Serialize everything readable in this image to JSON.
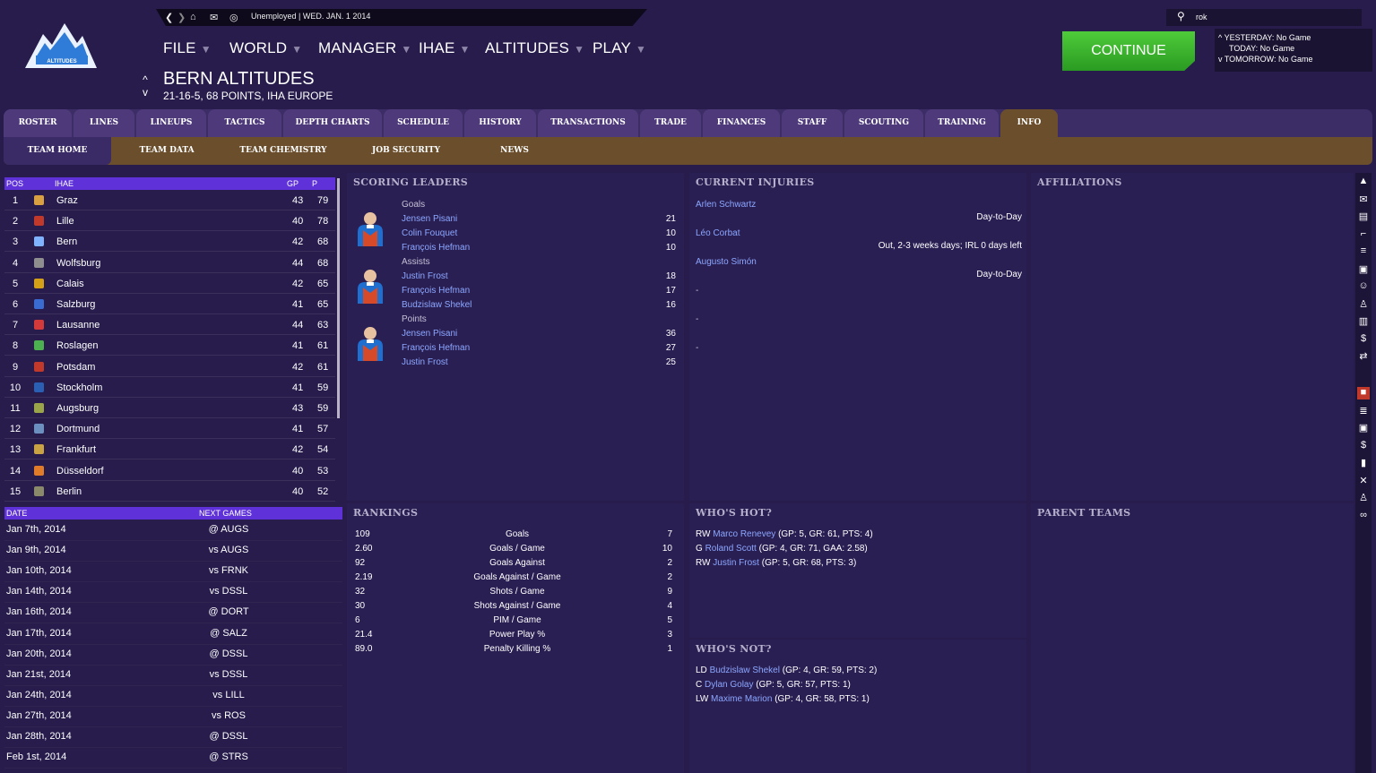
{
  "topbar": {
    "status": "Unemployed | WED. JAN. 1 2014"
  },
  "search": {
    "value": "rok"
  },
  "logo": {
    "text": "ALTITUDES"
  },
  "menu": [
    {
      "label": "FILE"
    },
    {
      "label": "WORLD"
    },
    {
      "label": "MANAGER"
    },
    {
      "label": "IHAE"
    },
    {
      "label": "ALTITUDES"
    },
    {
      "label": "PLAY"
    }
  ],
  "team": {
    "name": "BERN ALTITUDES",
    "record": "21-16-5, 68 POINTS, IHA EUROPE"
  },
  "continue_label": "CONTINUE",
  "schedule": {
    "yesterday": "YESTERDAY: No Game",
    "today": "TODAY: No Game",
    "tomorrow": "TOMORROW: No Game"
  },
  "tabs": [
    "ROSTER",
    "LINES",
    "LINEUPS",
    "TACTICS",
    "DEPTH CHARTS",
    "SCHEDULE",
    "HISTORY",
    "TRANSACTIONS",
    "TRADE",
    "FINANCES",
    "STAFF",
    "SCOUTING",
    "TRAINING",
    "INFO"
  ],
  "subtabs": [
    "TEAM HOME",
    "TEAM DATA",
    "TEAM CHEMISTRY",
    "JOB SECURITY",
    "NEWS"
  ],
  "standings": {
    "headers": {
      "pos": "POS",
      "league": "IHAE",
      "gp": "GP",
      "p": "P"
    },
    "rows": [
      {
        "pos": "1",
        "team": "Graz",
        "gp": "43",
        "p": "79",
        "color": "#d8a040"
      },
      {
        "pos": "2",
        "team": "Lille",
        "gp": "40",
        "p": "78",
        "color": "#c0392b"
      },
      {
        "pos": "3",
        "team": "Bern",
        "gp": "42",
        "p": "68",
        "color": "#7fb3ff"
      },
      {
        "pos": "4",
        "team": "Wolfsburg",
        "gp": "44",
        "p": "68",
        "color": "#8e8e8e"
      },
      {
        "pos": "5",
        "team": "Calais",
        "gp": "42",
        "p": "65",
        "color": "#d4a017"
      },
      {
        "pos": "6",
        "team": "Salzburg",
        "gp": "41",
        "p": "65",
        "color": "#3a6bd1"
      },
      {
        "pos": "7",
        "team": "Lausanne",
        "gp": "44",
        "p": "63",
        "color": "#d43a3a"
      },
      {
        "pos": "8",
        "team": "Roslagen",
        "gp": "41",
        "p": "61",
        "color": "#4caf50"
      },
      {
        "pos": "9",
        "team": "Potsdam",
        "gp": "42",
        "p": "61",
        "color": "#c0392b"
      },
      {
        "pos": "10",
        "team": "Stockholm",
        "gp": "41",
        "p": "59",
        "color": "#2b5fb3"
      },
      {
        "pos": "11",
        "team": "Augsburg",
        "gp": "43",
        "p": "59",
        "color": "#9aa54a"
      },
      {
        "pos": "12",
        "team": "Dortmund",
        "gp": "41",
        "p": "57",
        "color": "#6b8fbf"
      },
      {
        "pos": "13",
        "team": "Frankfurt",
        "gp": "42",
        "p": "54",
        "color": "#c9a243"
      },
      {
        "pos": "14",
        "team": "Düsseldorf",
        "gp": "40",
        "p": "53",
        "color": "#e07b2a"
      },
      {
        "pos": "15",
        "team": "Berlin",
        "gp": "40",
        "p": "52",
        "color": "#8a8a6a"
      }
    ]
  },
  "next_games": {
    "headers": {
      "date": "DATE",
      "next": "NEXT GAMES"
    },
    "rows": [
      {
        "date": "Jan 7th, 2014",
        "opp": "@ AUGS"
      },
      {
        "date": "Jan 9th, 2014",
        "opp": "vs AUGS"
      },
      {
        "date": "Jan 10th, 2014",
        "opp": "vs FRNK"
      },
      {
        "date": "Jan 14th, 2014",
        "opp": "vs DSSL"
      },
      {
        "date": "Jan 16th, 2014",
        "opp": "@ DORT"
      },
      {
        "date": "Jan 17th, 2014",
        "opp": "@ SALZ"
      },
      {
        "date": "Jan 20th, 2014",
        "opp": "@ DSSL"
      },
      {
        "date": "Jan 21st, 2014",
        "opp": "vs DSSL"
      },
      {
        "date": "Jan 24th, 2014",
        "opp": "vs LILL"
      },
      {
        "date": "Jan 27th, 2014",
        "opp": "vs ROS"
      },
      {
        "date": "Jan 28th, 2014",
        "opp": "@ DSSL"
      },
      {
        "date": "Feb 1st, 2014",
        "opp": "@ STRS"
      }
    ]
  },
  "scoring_leaders": {
    "title": "SCORING LEADERS",
    "groups": [
      {
        "label": "Goals",
        "players": [
          {
            "name": "Jensen Pisani",
            "val": "21"
          },
          {
            "name": "Colin Fouquet",
            "val": "10"
          },
          {
            "name": "François Hefman",
            "val": "10"
          }
        ]
      },
      {
        "label": "Assists",
        "players": [
          {
            "name": "Justin Frost",
            "val": "18"
          },
          {
            "name": "François Hefman",
            "val": "17"
          },
          {
            "name": "Budzislaw Shekel",
            "val": "16"
          }
        ]
      },
      {
        "label": "Points",
        "players": [
          {
            "name": "Jensen Pisani",
            "val": "36"
          },
          {
            "name": "François Hefman",
            "val": "27"
          },
          {
            "name": "Justin Frost",
            "val": "25"
          }
        ]
      }
    ]
  },
  "injuries": {
    "title": "CURRENT INJURIES",
    "rows": [
      {
        "name": "Arlen Schwartz",
        "status": "Day-to-Day"
      },
      {
        "name": "Léo Corbat",
        "status": "Out, 2-3 weeks days; IRL 0 days left"
      },
      {
        "name": "Augusto Simón",
        "status": "Day-to-Day"
      }
    ],
    "dashes": [
      "-",
      "-",
      "-"
    ]
  },
  "affiliations": {
    "title": "AFFILIATIONS"
  },
  "parent_teams": {
    "title": "PARENT TEAMS"
  },
  "rankings": {
    "title": "RANKINGS",
    "rows": [
      {
        "value": "109",
        "stat": "Goals",
        "rank": "7"
      },
      {
        "value": "2.60",
        "stat": "Goals / Game",
        "rank": "10"
      },
      {
        "value": "92",
        "stat": "Goals Against",
        "rank": "2"
      },
      {
        "value": "2.19",
        "stat": "Goals Against / Game",
        "rank": "2"
      },
      {
        "value": "32",
        "stat": "Shots / Game",
        "rank": "9"
      },
      {
        "value": "30",
        "stat": "Shots Against / Game",
        "rank": "4"
      },
      {
        "value": "6",
        "stat": "PIM / Game",
        "rank": "5"
      },
      {
        "value": "21.4",
        "stat": "Power Play %",
        "rank": "3"
      },
      {
        "value": "89.0",
        "stat": "Penalty Killing %",
        "rank": "1"
      }
    ]
  },
  "whos_hot": {
    "title": "WHO'S HOT?",
    "rows": [
      {
        "pos": "RW",
        "name": "Marco Renevey",
        "stats": "(GP: 5, GR: 61, PTS: 4)"
      },
      {
        "pos": "G",
        "name": "Roland Scott",
        "stats": "(GP: 4, GR: 71, GAA: 2.58)"
      },
      {
        "pos": "RW",
        "name": "Justin Frost",
        "stats": "(GP: 5, GR: 68, PTS: 3)"
      }
    ]
  },
  "whos_not": {
    "title": "WHO'S NOT?",
    "rows": [
      {
        "pos": "LD",
        "name": "Budzislaw Shekel",
        "stats": "(GP: 4, GR: 59, PTS: 2)"
      },
      {
        "pos": "C",
        "name": "Dylan Golay",
        "stats": "(GP: 5, GR: 57, PTS: 1)"
      },
      {
        "pos": "LW",
        "name": "Maxime Marion",
        "stats": "(GP: 4, GR: 58, PTS: 1)"
      }
    ]
  },
  "colors": {
    "accent": "#5f31d9",
    "tab": "#4e3a7b",
    "tab_active": "#6b4f2c",
    "continue": "#3cb831",
    "link": "#8ba7ff"
  },
  "side_icons": [
    "team-icon",
    "mail-icon",
    "clipboard-icon",
    "stick-icon",
    "list-icon",
    "rink-icon",
    "people-icon",
    "trophy-icon",
    "document-icon",
    "money-people-icon",
    "transfer-icon",
    "flag-icon",
    "list2-icon",
    "rink2-icon",
    "dollar-icon",
    "chart-icon",
    "sticks-icon",
    "trophy2-icon",
    "binoculars-icon"
  ]
}
